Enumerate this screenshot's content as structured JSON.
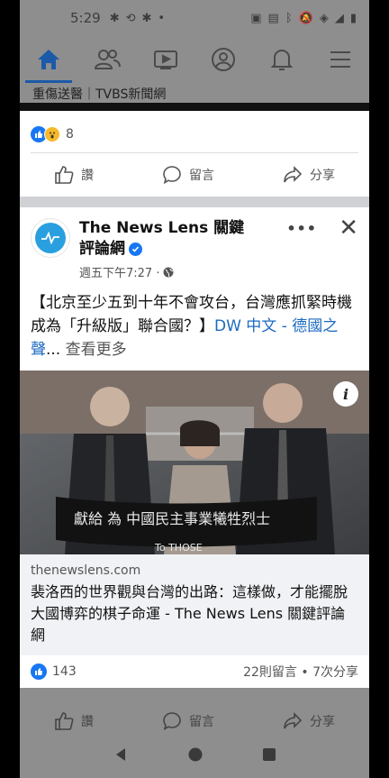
{
  "status": {
    "time": "5:29"
  },
  "partial_header": {
    "text": "重傷送醫｜TVBS新聞網"
  },
  "prev_post": {
    "reaction_count": "8",
    "actions": {
      "like": "讚",
      "comment": "留言",
      "share": "分享"
    }
  },
  "post": {
    "page_name": "The News Lens 關鍵評論網",
    "time": "週五下午7:27 ·",
    "text_main": "【北京至少五到十年不會攻台，台灣應抓緊時機成為「升級版」聯合國？】",
    "text_link": "DW 中文 - 德國之聲",
    "text_ellipsis": "...",
    "see_more": "查看更多",
    "photo_caption": "To THOSE",
    "link_domain": "thenewslens.com",
    "link_title": "裴洛西的世界觀與台灣的出路：這樣做，才能擺脫大國博弈的棋子命運 - The News Lens 關鍵評論網",
    "reaction_count": "143",
    "comments_shares": "22則留言 • 7次分享",
    "actions": {
      "like": "讚",
      "comment": "留言",
      "share": "分享"
    }
  },
  "colors": {
    "brand": "#1877f2",
    "overlay": "#8e8e8e"
  }
}
